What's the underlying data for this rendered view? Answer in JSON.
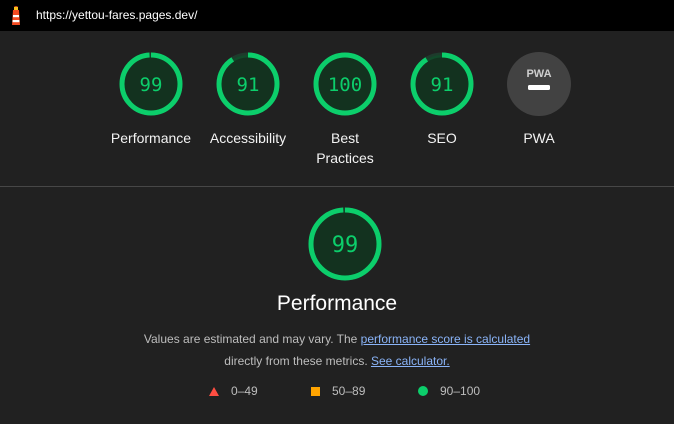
{
  "topbar": {
    "url": "https://yettou-fares.pages.dev/"
  },
  "gauges": [
    {
      "label": "Performance",
      "score": "99",
      "fraction": 0.99
    },
    {
      "label": "Accessibility",
      "score": "91",
      "fraction": 0.91
    },
    {
      "label": "Best Practices",
      "score": "100",
      "fraction": 1.0
    },
    {
      "label": "SEO",
      "score": "91",
      "fraction": 0.91
    },
    {
      "label": "PWA",
      "badge_text": "PWA"
    }
  ],
  "performance": {
    "score": "99",
    "fraction": 0.99,
    "title": "Performance",
    "desc_prefix": "Values are estimated and may vary. The ",
    "desc_link1": "performance score is calculated",
    "desc_middle": "directly from these metrics. ",
    "desc_link2": "See calculator."
  },
  "legend": [
    {
      "range": "0–49",
      "shape": "triangle",
      "color": "#ff4e42"
    },
    {
      "range": "50–89",
      "shape": "square",
      "color": "#ffa400"
    },
    {
      "range": "90–100",
      "shape": "circle",
      "color": "#0cce6b"
    }
  ],
  "colors": {
    "pass": "#0cce6b",
    "background": "#212121",
    "link": "#8ab4f8"
  }
}
